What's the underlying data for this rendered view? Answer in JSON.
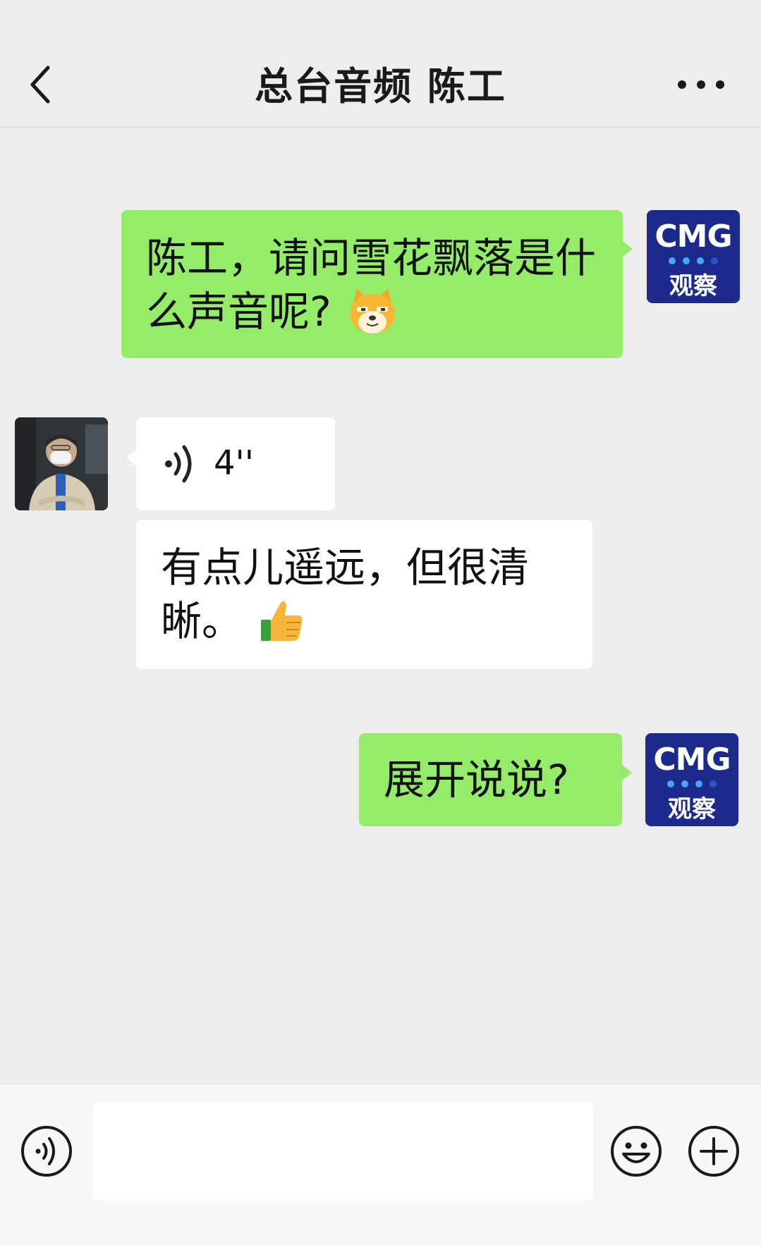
{
  "header": {
    "title": "总台音频 陈工"
  },
  "icons": {
    "back": "chevron-left-icon",
    "more": "more-dots-icon",
    "voice": "voice-icon",
    "emoji": "smiley-icon",
    "plus": "plus-icon"
  },
  "colors": {
    "my_bubble": "#95ec69",
    "other_bubble": "#ffffff",
    "background": "#ededed",
    "cmg_brand": "#1c2a8c"
  },
  "cmg_avatar": {
    "logo": "CMG",
    "sub": "观察"
  },
  "messages": [
    {
      "sender": "me",
      "text": "陈工，请问雪花飘落是什么声音呢?",
      "emoji": "doge-emoji"
    },
    {
      "sender": "other",
      "type": "voice",
      "duration": "4''"
    },
    {
      "sender": "other",
      "text": "有点儿遥远，但很清晰。",
      "emoji": "thumbs-up-emoji"
    },
    {
      "sender": "me",
      "text": "展开说说?"
    }
  ],
  "input": {
    "placeholder": ""
  }
}
